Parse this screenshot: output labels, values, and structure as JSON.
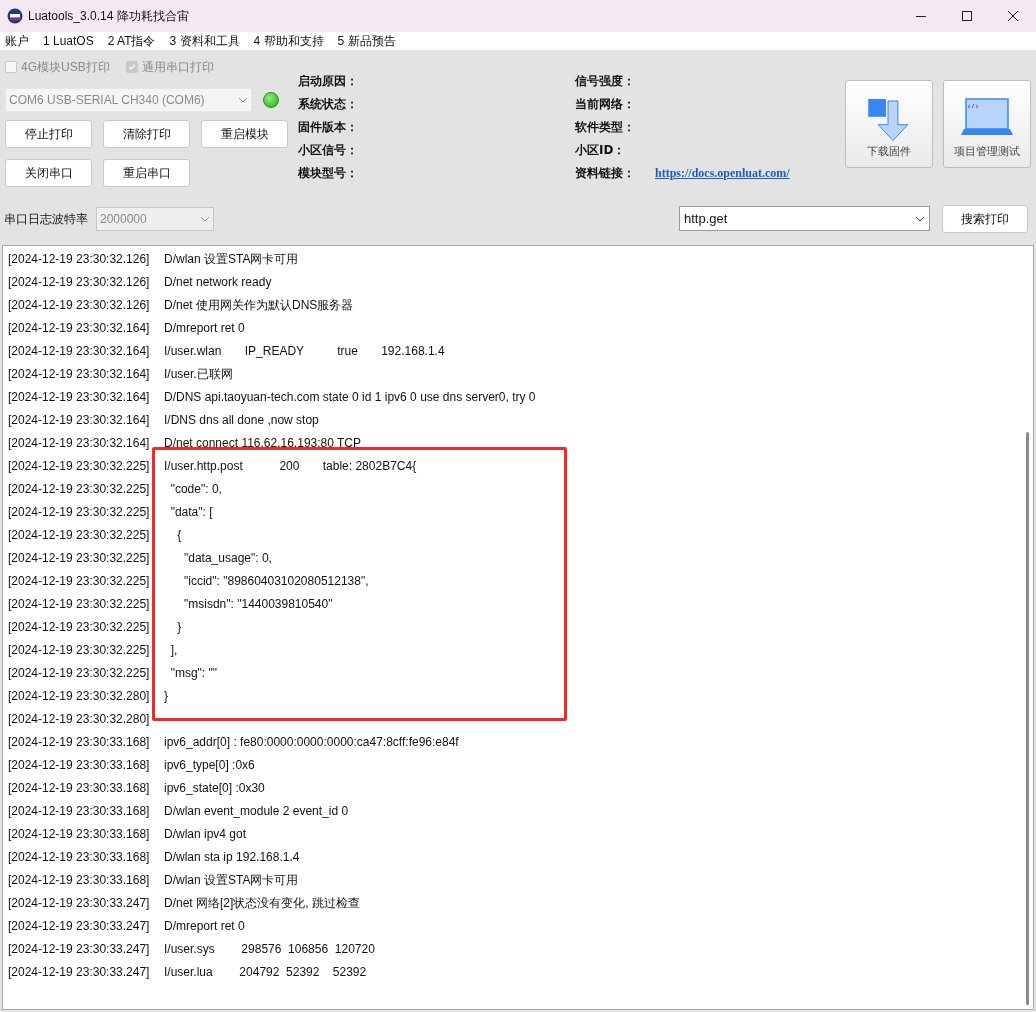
{
  "window": {
    "title": "Luatools_3.0.14 降功耗找合宙"
  },
  "menu": [
    "账户",
    "1 LuatOS",
    "2 AT指令",
    "3 资料和工具",
    "4 帮助和支持",
    "5 新品预告"
  ],
  "checkboxes": [
    {
      "label": "4G模块USB打印",
      "checked": false,
      "disabled": true
    },
    {
      "label": "通用串口打印",
      "checked": true,
      "disabled": true
    }
  ],
  "port_select": {
    "value": "COM6 USB-SERIAL CH340 (COM6)",
    "disabled": true
  },
  "connection_led": {
    "on": true
  },
  "buttons_row1": [
    "停止打印",
    "清除打印",
    "重启模块"
  ],
  "buttons_row2": [
    "关闭串口",
    "重启串口"
  ],
  "baud": {
    "label": "串口日志波特率",
    "value": "2000000",
    "disabled": true
  },
  "info_left": [
    "启动原因：",
    "系统状态：",
    "固件版本：",
    "小区信号：",
    "模块型号："
  ],
  "info_right": [
    "信号强度：",
    "当前网络：",
    "软件类型：",
    "小区ID：",
    "资料链接："
  ],
  "docs_link": "https://docs.openluat.com/",
  "tool_buttons": [
    {
      "kind": "download",
      "label": "下载固件"
    },
    {
      "kind": "project",
      "label": "项目管理测试"
    }
  ],
  "search": {
    "value": "http.get",
    "button": "搜索打印"
  },
  "log_lines": [
    {
      "time": "[2024-12-19 23:30:32.126]",
      "message": "D/wlan 设置STA网卡可用"
    },
    {
      "time": "[2024-12-19 23:30:32.126]",
      "message": "D/net network ready"
    },
    {
      "time": "[2024-12-19 23:30:32.126]",
      "message": "D/net 使用网关作为默认DNS服务器"
    },
    {
      "time": "[2024-12-19 23:30:32.164]",
      "message": "D/mreport ret 0"
    },
    {
      "time": "[2024-12-19 23:30:32.164]",
      "message": "I/user.wlan       IP_READY          true       192.168.1.4"
    },
    {
      "time": "[2024-12-19 23:30:32.164]",
      "message": "I/user.已联网"
    },
    {
      "time": "[2024-12-19 23:30:32.164]",
      "message": "D/DNS api.taoyuan-tech.com state 0 id 1 ipv6 0 use dns server0, try 0"
    },
    {
      "time": "[2024-12-19 23:30:32.164]",
      "message": "I/DNS dns all done ,now stop"
    },
    {
      "time": "[2024-12-19 23:30:32.164]",
      "message": "D/net connect 116.62.16.193:80 TCP"
    },
    {
      "time": "[2024-12-19 23:30:32.225]",
      "message": "I/user.http.post           200       table: 2802B7C4{"
    },
    {
      "time": "[2024-12-19 23:30:32.225]",
      "message": "  \"code\": 0,"
    },
    {
      "time": "[2024-12-19 23:30:32.225]",
      "message": "  \"data\": ["
    },
    {
      "time": "[2024-12-19 23:30:32.225]",
      "message": "    {"
    },
    {
      "time": "[2024-12-19 23:30:32.225]",
      "message": "      \"data_usage\": 0,"
    },
    {
      "time": "[2024-12-19 23:30:32.225]",
      "message": "      \"iccid\": \"89860403102080512138\","
    },
    {
      "time": "[2024-12-19 23:30:32.225]",
      "message": "      \"msisdn\": \"1440039810540\""
    },
    {
      "time": "[2024-12-19 23:30:32.225]",
      "message": "    }"
    },
    {
      "time": "[2024-12-19 23:30:32.225]",
      "message": "  ],"
    },
    {
      "time": "[2024-12-19 23:30:32.225]",
      "message": "  \"msg\": \"\""
    },
    {
      "time": "[2024-12-19 23:30:32.280]",
      "message": "}"
    },
    {
      "time": "[2024-12-19 23:30:32.280]"
    },
    {
      "time": "[2024-12-19 23:30:33.168]",
      "message": "ipv6_addr[0] : fe80:0000:0000:0000:ca47:8cff:fe96:e84f"
    },
    {
      "time": "[2024-12-19 23:30:33.168]",
      "message": "ipv6_type[0] :0x6"
    },
    {
      "time": "[2024-12-19 23:30:33.168]",
      "message": "ipv6_state[0] :0x30"
    },
    {
      "time": "[2024-12-19 23:30:33.168]",
      "message": "D/wlan event_module 2 event_id 0"
    },
    {
      "time": "[2024-12-19 23:30:33.168]",
      "message": "D/wlan ipv4 got"
    },
    {
      "time": "[2024-12-19 23:30:33.168]",
      "message": "D/wlan sta ip 192.168.1.4"
    },
    {
      "time": "[2024-12-19 23:30:33.168]",
      "message": "D/wlan 设置STA网卡可用"
    },
    {
      "time": "[2024-12-19 23:30:33.247]",
      "message": "D/net 网络[2]状态没有变化, 跳过检查"
    },
    {
      "time": "[2024-12-19 23:30:33.247]",
      "message": "D/mreport ret 0"
    },
    {
      "time": "[2024-12-19 23:30:33.247]",
      "message": "I/user.sys        298576  106856  120720"
    },
    {
      "time": "[2024-12-19 23:30:33.247]",
      "message": "I/user.lua        204792  52392    52392"
    }
  ]
}
